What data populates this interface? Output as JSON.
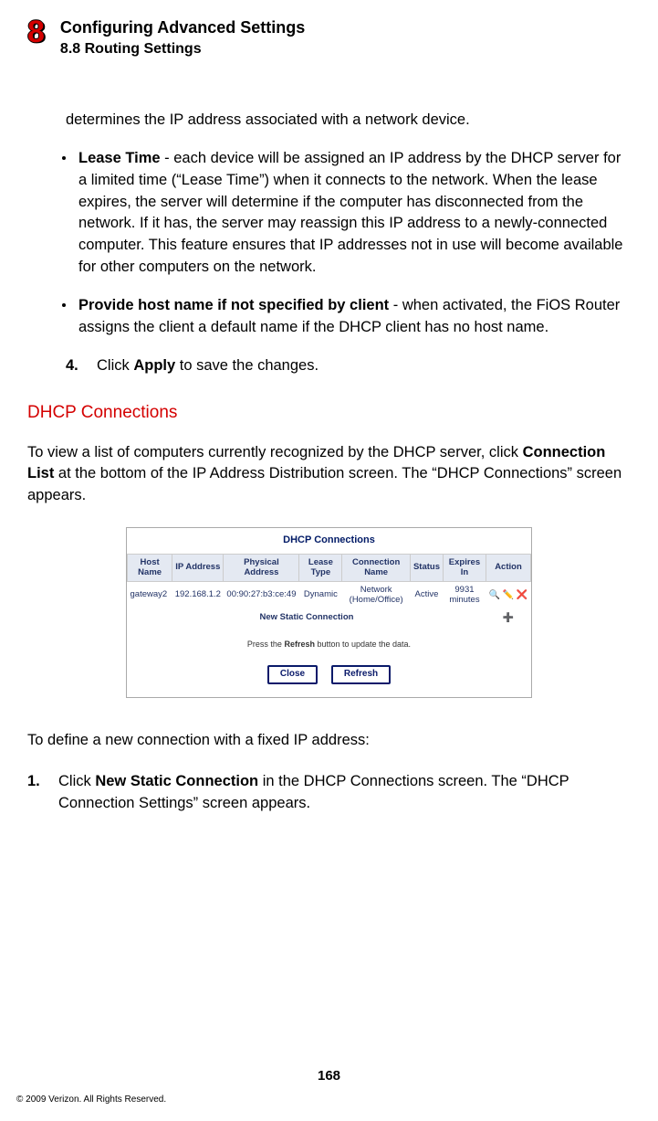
{
  "header": {
    "chapter_num": "8",
    "title": "Configuring Advanced Settings",
    "subtitle": "8.8 Routing Settings"
  },
  "lead_fragment": "determines the IP address associated with a network device.",
  "bullets": [
    {
      "term": "Lease Time",
      "text": " - each device will be assigned an IP address by the DHCP server for a limited time (“Lease Time”) when it connects to the network. When the lease expires, the server will determine if the computer has disconnected from the network. If it has, the server may reassign this IP address to a newly-connected computer. This feature ensures that IP addresses not in use will become available for other computers on the network."
    },
    {
      "term": "Provide host name if not specified by client",
      "text": " - when activated, the FiOS Router assigns the client a default name if the DHCP client has no host name."
    }
  ],
  "step4": {
    "num": "4.",
    "pre": "Click ",
    "bold": "Apply",
    "post": " to save the changes."
  },
  "section_title": "DHCP Connections",
  "p_intro": {
    "pre": "To view a list of computers currently recognized by the DHCP server, click ",
    "bold": "Connection List",
    "post": " at the bottom of the IP Address Distribution screen. The “DHCP Connections” screen appears."
  },
  "ui": {
    "title": "DHCP Connections",
    "columns": [
      "Host Name",
      "IP Address",
      "Physical Address",
      "Lease Type",
      "Connection Name",
      "Status",
      "Expires In",
      "Action"
    ],
    "row": {
      "host": "gateway2",
      "ip": "192.168.1.2",
      "mac": "00:90:27:b3:ce:49",
      "lease": "Dynamic",
      "conn": "Network (Home/Office)",
      "status": "Active",
      "expires": "9931 minutes"
    },
    "new_static": "New Static Connection",
    "hint_pre": "Press the ",
    "hint_bold": "Refresh",
    "hint_post": " button to update the data.",
    "btn_close": "Close",
    "btn_refresh": "Refresh"
  },
  "p_define": "To define a new connection with a fixed IP address:",
  "step1": {
    "num": "1.",
    "pre": "Click ",
    "bold": "New Static Connection",
    "post": " in the DHCP Connections screen. The “DHCP Connection Settings” screen appears."
  },
  "page_number": "168",
  "copyright": "© 2009 Verizon. All Rights Reserved."
}
